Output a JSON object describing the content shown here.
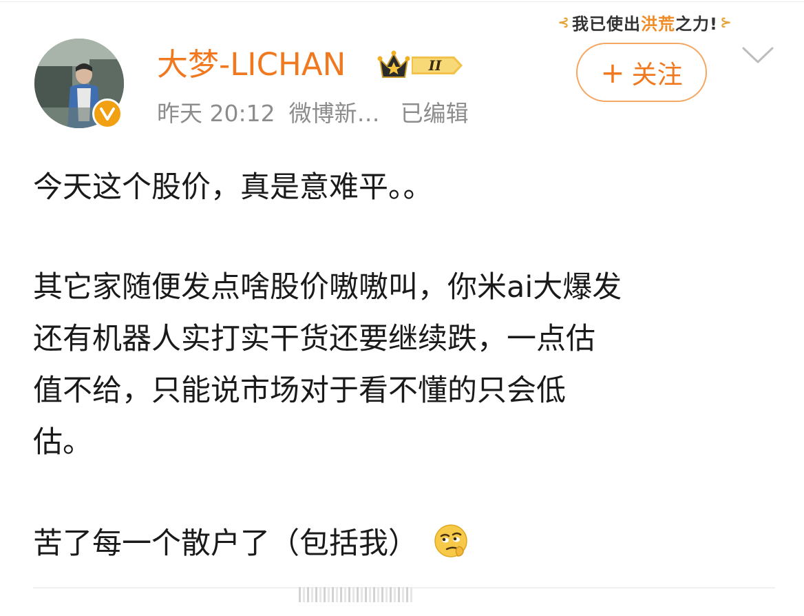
{
  "sticker": {
    "text_1": "我已使出",
    "text_2": "洪荒",
    "text_3": "之力!",
    "left_deco": "⊰",
    "right_deco": "⊱"
  },
  "user": {
    "name": "大梦-LICHAN",
    "verified_icon": "verified-v-badge-icon",
    "member_level": "II",
    "member_badge_icon": "crown-vip-badge-icon"
  },
  "meta": {
    "time": "昨天 20:12",
    "source": "微博新…",
    "edited": "已编辑"
  },
  "follow_button": {
    "plus": "+",
    "label": "关注"
  },
  "post": {
    "lines": [
      "今天这个股价，真是意难平。。",
      "其它家随便发点啥股价嗷嗷叫，你米ai大爆发",
      "还有机器人实打实干货还要继续跌，一点估",
      "值不给，只能说市场对于看不懂的只会低",
      "估。",
      "苦了每一个散户了（包括我）"
    ],
    "trailing_emoji": "thinking-face-emoji-icon"
  },
  "colors": {
    "accent_orange": "#f0781e",
    "follow_border": "#f5a663",
    "meta_gray": "#8c8c8c",
    "body_text": "#1a1a1a",
    "badge_gold": "#f0a010"
  }
}
